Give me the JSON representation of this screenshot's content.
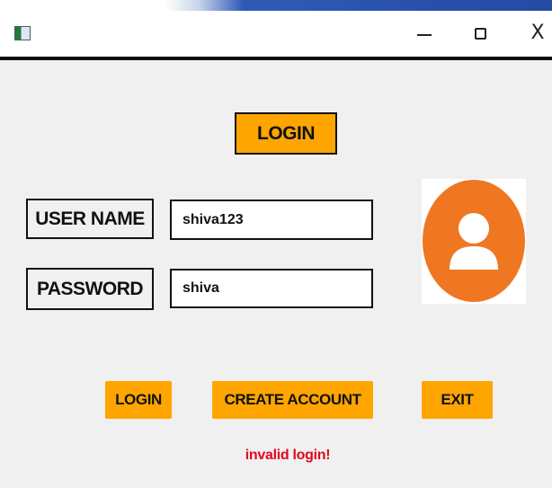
{
  "window": {
    "controls": {
      "minimize_glyph": "—",
      "maximize_glyph": "☐",
      "close_glyph": "X"
    },
    "icon": "app-window-icon"
  },
  "form": {
    "title": "LOGIN",
    "username": {
      "label": "USER NAME",
      "value": "shiva123"
    },
    "password": {
      "label": "PASSWORD",
      "value": "shiva"
    },
    "avatar_icon": "user-avatar-icon"
  },
  "buttons": {
    "login": "LOGIN",
    "create_account": "CREATE ACCOUNT",
    "exit": "EXIT"
  },
  "status": {
    "message": "invalid login!"
  },
  "colors": {
    "accent": "#ffa500",
    "avatar": "#ef7722",
    "error": "#e3071d"
  }
}
